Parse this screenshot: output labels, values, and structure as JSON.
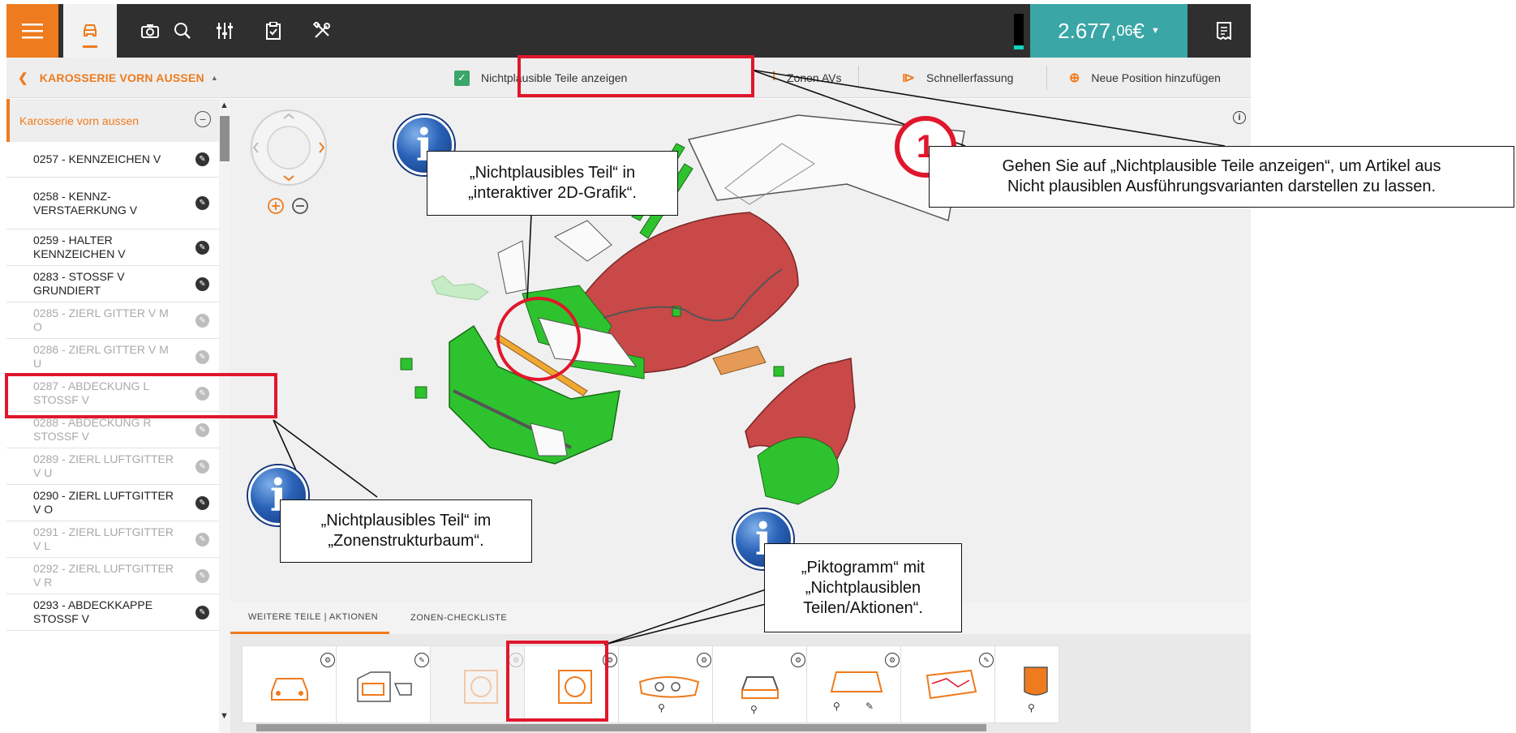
{
  "topbar": {
    "icons": [
      "menu-icon",
      "car-icon",
      "camera-icon",
      "search-icon",
      "sliders-icon",
      "checklist-icon",
      "tools-icon"
    ],
    "price_main": "2.677,",
    "price_cents": "06",
    "price_currency": " €",
    "receipt_icon": "receipt-icon"
  },
  "subbar": {
    "breadcrumb": "KAROSSERIE VORN AUSSEN",
    "show_implausible_label": "Nichtplausible Teile anzeigen",
    "zones_label": "Zonen AVs",
    "quick_entry_label": "Schnellerfassung",
    "add_position_label": "Neue Position hinzufügen"
  },
  "tree": {
    "header": "Karosserie vorn aussen",
    "items": [
      {
        "label": "0257 - KENNZEICHEN V",
        "dim": false
      },
      {
        "label": "0258 - KENNZ-VERSTAERKUNG V",
        "dim": false
      },
      {
        "label": "0259 - HALTER KENNZEICHEN V",
        "dim": false
      },
      {
        "label": "0283 - STOSSF V GRUNDIERT",
        "dim": false
      },
      {
        "label": "0285 - ZIERL GITTER V M O",
        "dim": true
      },
      {
        "label": "0286 - ZIERL GITTER V M U",
        "dim": true
      },
      {
        "label": "0287 - ABDECKUNG L STOSSF V",
        "dim": true
      },
      {
        "label": "0288 - ABDECKUNG R STOSSF V",
        "dim": true
      },
      {
        "label": "0289 - ZIERL LUFTGITTER V U",
        "dim": true
      },
      {
        "label": "0290 - ZIERL LUFTGITTER V O",
        "dim": false
      },
      {
        "label": "0291 - ZIERL LUFTGITTER V L",
        "dim": true
      },
      {
        "label": "0292 - ZIERL LUFTGITTER V R",
        "dim": true
      },
      {
        "label": "0293 - ABDECKKAPPE STOSSF V",
        "dim": false
      }
    ]
  },
  "tabs": {
    "more_parts": "WEITERE TEILE | AKTIONEN",
    "zone_checklist": "ZONEN-CHECKLISTE"
  },
  "annotations": {
    "step_number": "1",
    "step_text_1": "Gehen Sie auf „Nichtplausible Teile anzeigen“, um Artikel aus",
    "step_text_2": "Nicht plausiblen Ausführungsvarianten darstellen zu lassen.",
    "info_2d_1": "„Nichtplausibles Teil“ in",
    "info_2d_2": "„interaktiver 2D-Grafik“.",
    "info_tree_1": "„Nichtplausibles Teil“ im",
    "info_tree_2": "„Zonenstrukturbaum“.",
    "info_picto_1": "„Piktogramm“ mit",
    "info_picto_2": "„Nichtplausiblen",
    "info_picto_3": "Teilen/Aktionen“.",
    "info_letter": "i"
  },
  "colors": {
    "accent": "#ee7b1e",
    "teal": "#3aa6a6",
    "highlight_red": "#e0172c",
    "part_green": "#2fc22f",
    "part_red": "#c94848"
  }
}
